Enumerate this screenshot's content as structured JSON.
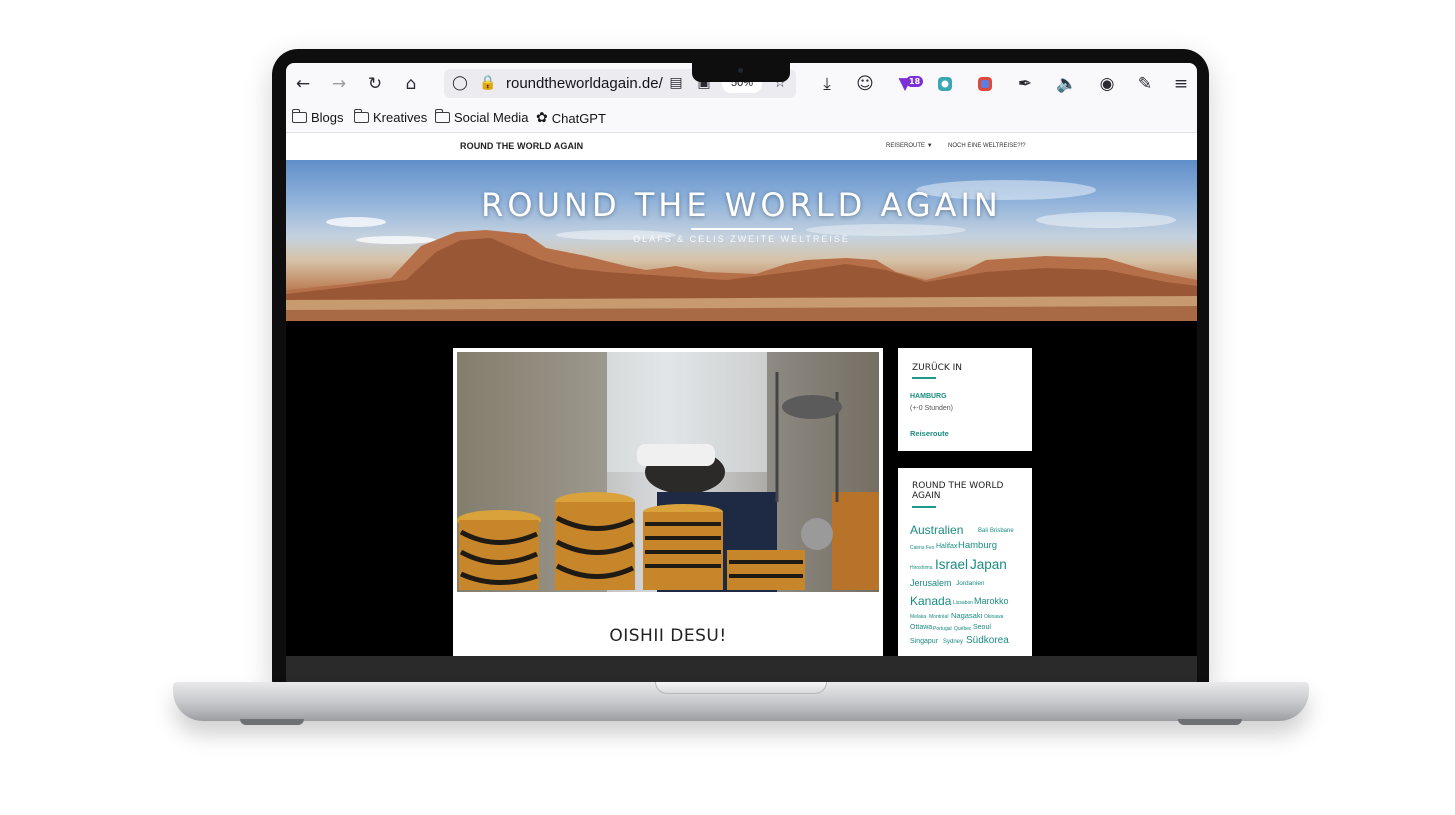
{
  "browser": {
    "url": "roundtheworldagain.de/",
    "zoom": "50%",
    "extension_badge": "18",
    "icons": [
      "back-icon",
      "forward-icon",
      "reload-icon",
      "home-icon",
      "shield-icon",
      "lock-icon",
      "reader-icon",
      "pocket-icon",
      "star-icon",
      "download-icon",
      "account-icon",
      "extension-icon",
      "screenshot-icon",
      "color-icon",
      "eyedropper-icon",
      "speaker-icon",
      "password-icon",
      "puzzle-icon",
      "menu-icon"
    ]
  },
  "bookmarks": [
    {
      "label": "Blogs",
      "icon": "folder-icon"
    },
    {
      "label": "Kreatives",
      "icon": "folder-icon"
    },
    {
      "label": "Social Media",
      "icon": "folder-icon"
    },
    {
      "label": "ChatGPT",
      "icon": "chatgpt-icon"
    }
  ],
  "site": {
    "brand": "ROUND THE WORLD AGAIN",
    "menu": [
      "REISEROUTE",
      "NOCH EINE WELTREISE?!?"
    ],
    "hero_title": "ROUND THE WORLD AGAIN",
    "hero_subtitle": "OLAFS & CELIS ZWEITE WELTREISE",
    "post_title": "OISHII DESU!",
    "widget1": {
      "title": "ZURÜCK IN",
      "place": "HAMBURG",
      "offset": "(+-0 Stunden)",
      "link": "Reiseroute"
    },
    "widget2": {
      "title": "ROUND THE WORLD AGAIN",
      "tags": [
        "Australien",
        "Bali",
        "Brisbane",
        "Cairns",
        "Fes",
        "Halifax",
        "Hamburg",
        "Hiroshima",
        "Israel",
        "Japan",
        "Jerusalem",
        "Jordanien",
        "Kanada",
        "Lissabon",
        "Marokko",
        "Melaka",
        "Montréal",
        "Nagasaki",
        "Okinawa",
        "Ottawa",
        "Portugal",
        "Québec",
        "Seoul",
        "Singapur",
        "Sydney",
        "Südkorea"
      ]
    }
  },
  "colors": {
    "accent": "#1b8c80",
    "hero_sky": "#8fb2db",
    "laptop": "#0e0e0e"
  }
}
